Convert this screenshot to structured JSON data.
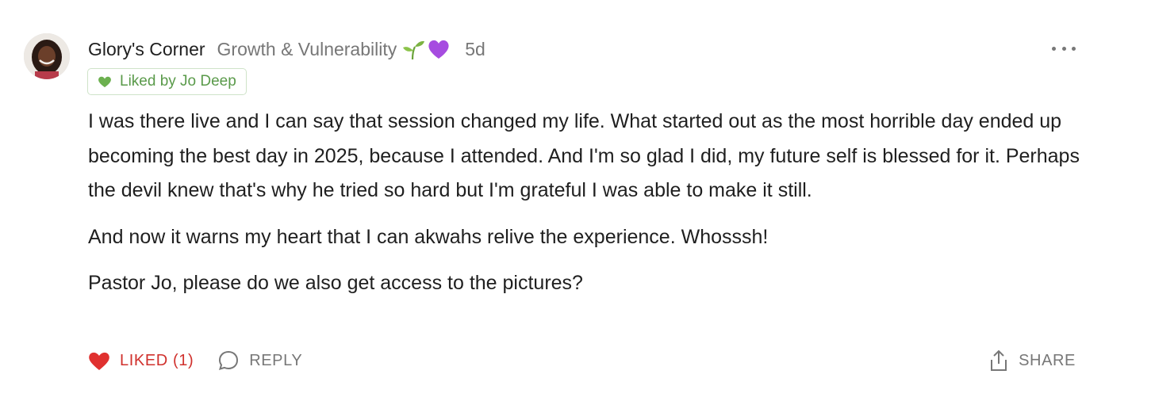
{
  "comment": {
    "author": "Glory's Corner",
    "badge": "Growth & Vulnerability",
    "badge_emojis": [
      "seedling-icon",
      "purple-heart-icon"
    ],
    "time_ago": "5d",
    "liked_by": "Liked by Jo Deep",
    "paragraphs": [
      "I was there live and I can say that session changed my life. What started out as the most horrible day ended up becoming the best day in 2025, because I attended. And I'm so glad I did, my future self is blessed for it. Perhaps the devil knew that's why he tried so hard but I'm grateful I was able to make it still.",
      "And now it warns my heart that I can akwahs relive the experience. Whosssh!",
      "Pastor Jo, please do we also get access to the pictures?"
    ]
  },
  "actions": {
    "liked_label": "LIKED (1)",
    "reply_label": "REPLY",
    "share_label": "SHARE"
  },
  "colors": {
    "liked_red": "#d0312d",
    "liked_by_green": "#5a9a4a",
    "muted_gray": "#777777"
  }
}
